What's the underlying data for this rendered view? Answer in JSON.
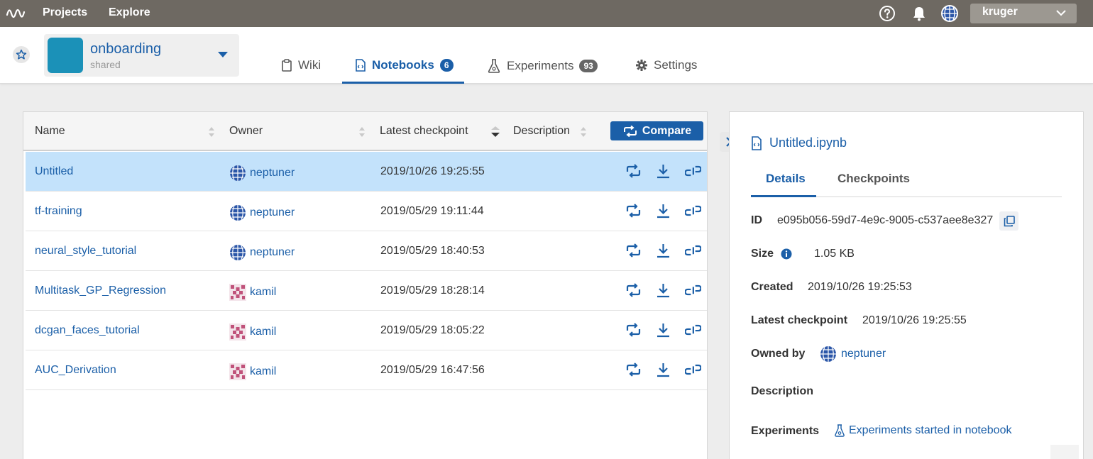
{
  "topbar": {
    "logo_icon": "neptune-wave-logo",
    "nav": [
      "Projects",
      "Explore"
    ],
    "help_icon": "help-circle-icon",
    "bell_icon": "bell-icon",
    "user_avatar_icon": "globe-avatar-icon",
    "user_name": "kruger"
  },
  "project": {
    "name": "onboarding",
    "visibility": "shared",
    "color": "#1b91b8"
  },
  "tabs": [
    {
      "label": "Wiki",
      "icon": "document-icon"
    },
    {
      "label": "Notebooks",
      "icon": "notebook-icon",
      "badge": "6",
      "active": true
    },
    {
      "label": "Experiments",
      "icon": "flask-icon",
      "badge": "93"
    },
    {
      "label": "Settings",
      "icon": "gear-icon"
    }
  ],
  "table": {
    "columns": [
      "Name",
      "Owner",
      "Latest checkpoint",
      "Description"
    ],
    "compare_label": "Compare",
    "rows": [
      {
        "name": "Untitled",
        "owner": "neptuner",
        "checkpoint": "2019/10/26 19:25:55",
        "selected": true
      },
      {
        "name": "tf-training",
        "owner": "neptuner",
        "checkpoint": "2019/05/29 19:11:44"
      },
      {
        "name": "neural_style_tutorial",
        "owner": "neptuner",
        "checkpoint": "2019/05/29 18:40:53"
      },
      {
        "name": "Multitask_GP_Regression",
        "owner": "kamil",
        "checkpoint": "2019/05/29 18:28:14"
      },
      {
        "name": "dcgan_faces_tutorial",
        "owner": "kamil",
        "checkpoint": "2019/05/29 18:05:22"
      },
      {
        "name": "AUC_Derivation",
        "owner": "kamil",
        "checkpoint": "2019/05/29 16:47:56"
      }
    ]
  },
  "details": {
    "title": "Untitled.ipynb",
    "tabs": [
      "Details",
      "Checkpoints"
    ],
    "id_label": "ID",
    "id_value": "e095b056-59d7-4e9c-9005-c537aee8e327",
    "size_label": "Size",
    "size_value": "1.05 KB",
    "created_label": "Created",
    "created_value": "2019/10/26 19:25:53",
    "latest_label": "Latest checkpoint",
    "latest_value": "2019/10/26 19:25:55",
    "owned_label": "Owned by",
    "owned_value": "neptuner",
    "description_label": "Description",
    "experiments_label": "Experiments",
    "experiments_link": "Experiments started in notebook"
  },
  "colors": {
    "topbar": "#6e6962",
    "accent": "#1b5fa8",
    "selected_row": "#c3e2fb"
  }
}
